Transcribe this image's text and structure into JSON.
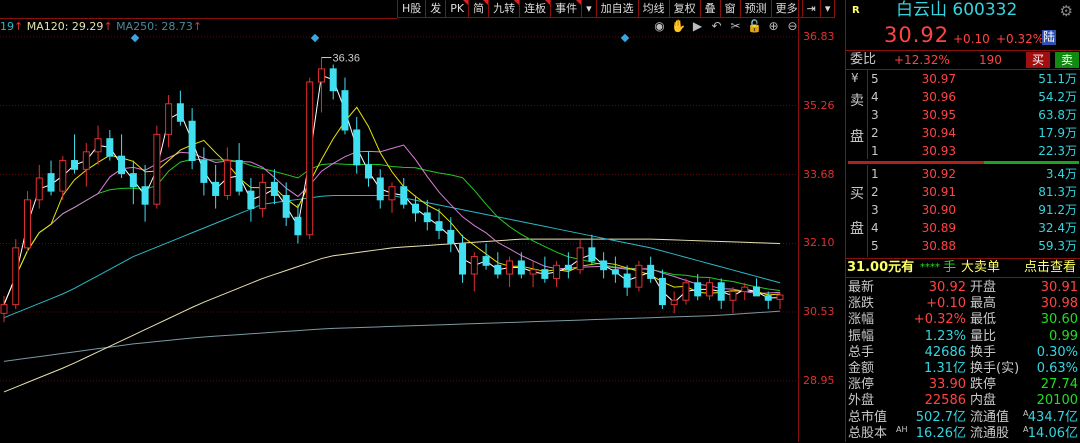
{
  "legend": {
    "partial": "19",
    "ma120": "MA120: 29.29",
    "ma250": "MA250: 28.73",
    "arrow": "↑"
  },
  "toolbar": [
    "H股",
    "发",
    "PK",
    "简",
    "九转",
    "连板",
    "事件",
    "▾",
    "加自选",
    "均线",
    "复权",
    "叠",
    "窗",
    "预测",
    "更多",
    "⇥",
    "▾"
  ],
  "toolbar_flags": [
    false,
    false,
    true,
    true,
    true,
    true,
    true,
    false,
    false,
    false,
    false,
    false,
    false,
    false,
    false,
    false,
    false
  ],
  "chart_icons": [
    "eye-icon",
    "hand-icon",
    "play-icon",
    "undo-icon",
    "scissors-icon",
    "lock-icon",
    "zoom-in-icon",
    "zoom-out-icon"
  ],
  "chart_icon_glyphs": [
    "◉",
    "✋",
    "▶",
    "↶",
    "✂",
    "🔓",
    "⊕",
    "⊖"
  ],
  "colors": {
    "up": "#e03030",
    "down": "#40e0f0",
    "ma5": "#ffffff",
    "ma10": "#e6e600",
    "ma20": "#d67fd6",
    "ma30": "#22cc22",
    "ma60": "#2bb8c8",
    "ma120": "#e8e0b0",
    "ma250": "#7a9aa0"
  },
  "chart_data": {
    "type": "candlestick",
    "y_ticks": [
      "36.83",
      "35.26",
      "33.68",
      "32.10",
      "30.53",
      "28.95"
    ],
    "ylim": [
      28.95,
      36.83
    ],
    "high_label": "36.36",
    "candles": [
      [
        30.5,
        30.9,
        30.3,
        30.7
      ],
      [
        30.7,
        32.2,
        30.6,
        32.0
      ],
      [
        32.0,
        33.3,
        31.9,
        33.1
      ],
      [
        33.1,
        33.9,
        32.9,
        33.6
      ],
      [
        33.7,
        34.0,
        33.2,
        33.3
      ],
      [
        33.3,
        34.1,
        33.1,
        34.0
      ],
      [
        34.0,
        34.6,
        33.7,
        33.8
      ],
      [
        33.8,
        34.4,
        33.4,
        34.2
      ],
      [
        34.2,
        34.8,
        33.9,
        34.5
      ],
      [
        34.5,
        34.7,
        34.0,
        34.1
      ],
      [
        34.1,
        34.6,
        33.6,
        33.7
      ],
      [
        33.7,
        34.0,
        33.0,
        33.4
      ],
      [
        33.4,
        33.9,
        32.6,
        33.0
      ],
      [
        33.0,
        34.8,
        32.9,
        34.6
      ],
      [
        34.6,
        35.5,
        34.3,
        35.3
      ],
      [
        35.3,
        35.6,
        34.8,
        34.9
      ],
      [
        34.9,
        35.2,
        33.8,
        34.0
      ],
      [
        34.0,
        34.3,
        33.2,
        33.5
      ],
      [
        33.5,
        33.9,
        32.9,
        33.2
      ],
      [
        33.2,
        34.3,
        33.1,
        34.0
      ],
      [
        34.0,
        34.4,
        33.2,
        33.3
      ],
      [
        33.3,
        33.6,
        32.6,
        32.9
      ],
      [
        32.9,
        33.7,
        32.7,
        33.5
      ],
      [
        33.5,
        33.8,
        33.0,
        33.2
      ],
      [
        33.2,
        33.5,
        32.5,
        32.7
      ],
      [
        32.7,
        33.0,
        32.1,
        32.3
      ],
      [
        32.3,
        35.9,
        32.2,
        35.8
      ],
      [
        35.8,
        36.36,
        35.1,
        36.1
      ],
      [
        36.1,
        36.2,
        35.4,
        35.6
      ],
      [
        35.6,
        35.9,
        34.6,
        34.7
      ],
      [
        34.7,
        35.0,
        33.7,
        33.9
      ],
      [
        33.9,
        34.2,
        33.4,
        33.6
      ],
      [
        33.6,
        33.8,
        32.9,
        33.1
      ],
      [
        33.1,
        33.5,
        32.8,
        33.4
      ],
      [
        33.4,
        33.6,
        32.9,
        33.0
      ],
      [
        33.0,
        33.2,
        32.6,
        32.8
      ],
      [
        32.8,
        33.1,
        32.4,
        32.6
      ],
      [
        32.6,
        32.9,
        32.2,
        32.4
      ],
      [
        32.4,
        32.7,
        31.9,
        32.1
      ],
      [
        32.1,
        32.3,
        31.2,
        31.4
      ],
      [
        31.4,
        31.9,
        31.0,
        31.8
      ],
      [
        31.8,
        32.1,
        31.5,
        31.6
      ],
      [
        31.6,
        31.9,
        31.3,
        31.4
      ],
      [
        31.4,
        31.8,
        31.1,
        31.7
      ],
      [
        31.7,
        31.9,
        31.3,
        31.4
      ],
      [
        31.4,
        31.7,
        31.1,
        31.5
      ],
      [
        31.5,
        31.8,
        31.2,
        31.3
      ],
      [
        31.3,
        31.7,
        31.1,
        31.6
      ],
      [
        31.6,
        31.9,
        31.3,
        31.5
      ],
      [
        31.5,
        32.2,
        31.4,
        32.0
      ],
      [
        32.0,
        32.3,
        31.6,
        31.7
      ],
      [
        31.7,
        31.9,
        31.3,
        31.5
      ],
      [
        31.5,
        31.8,
        31.2,
        31.4
      ],
      [
        31.4,
        31.6,
        30.9,
        31.1
      ],
      [
        31.1,
        31.7,
        31.0,
        31.6
      ],
      [
        31.6,
        31.8,
        31.2,
        31.3
      ],
      [
        31.3,
        31.5,
        30.6,
        30.7
      ],
      [
        30.7,
        31.0,
        30.5,
        30.8
      ],
      [
        30.8,
        31.3,
        30.7,
        31.2
      ],
      [
        31.2,
        31.4,
        30.8,
        30.9
      ],
      [
        30.9,
        31.3,
        30.8,
        31.2
      ],
      [
        31.2,
        31.3,
        30.6,
        30.8
      ],
      [
        30.8,
        31.1,
        30.5,
        31.0
      ],
      [
        31.0,
        31.2,
        30.8,
        31.1
      ],
      [
        31.1,
        31.3,
        30.9,
        30.9
      ],
      [
        30.9,
        31.0,
        30.6,
        30.8
      ],
      [
        30.82,
        30.98,
        30.6,
        30.92
      ]
    ],
    "ma_coarse": {
      "ma60": [
        30.4,
        31.0,
        31.8,
        32.4,
        33.0,
        33.2,
        33.2,
        32.9,
        32.6,
        32.3,
        32.0,
        31.6,
        31.2
      ],
      "ma120": [
        28.7,
        29.3,
        30.0,
        30.7,
        31.3,
        31.8,
        32.0,
        32.1,
        32.2,
        32.2,
        32.2,
        32.15,
        32.1
      ],
      "ma250": [
        29.4,
        29.6,
        29.8,
        29.95,
        30.05,
        30.15,
        30.2,
        30.25,
        30.3,
        30.35,
        30.4,
        30.45,
        30.55
      ]
    }
  },
  "panel": {
    "r_badge": "R",
    "name": "白云山 600332",
    "price": "30.92",
    "change": "+0.10",
    "pct": "+0.32%",
    "lu": "陆",
    "weibi_label": "委比",
    "weibi": "+12.32%",
    "weicha": "190",
    "buy_btn": "买",
    "sell_btn": "卖",
    "yen": "¥",
    "sell_side": [
      "卖",
      "盘"
    ],
    "buy_side": [
      "买",
      "盘"
    ],
    "asks": [
      {
        "lvl": "5",
        "p": "30.97",
        "v": "51.1万"
      },
      {
        "lvl": "4",
        "p": "30.96",
        "v": "54.2万"
      },
      {
        "lvl": "3",
        "p": "30.95",
        "v": "63.8万"
      },
      {
        "lvl": "2",
        "p": "30.94",
        "v": "17.9万"
      },
      {
        "lvl": "1",
        "p": "30.93",
        "v": "22.3万"
      }
    ],
    "bids": [
      {
        "lvl": "1",
        "p": "30.92",
        "v": "3.4万"
      },
      {
        "lvl": "2",
        "p": "30.91",
        "v": "81.3万"
      },
      {
        "lvl": "3",
        "p": "30.90",
        "v": "91.2万"
      },
      {
        "lvl": "4",
        "p": "30.89",
        "v": "32.4万"
      },
      {
        "lvl": "5",
        "p": "30.88",
        "v": "59.3万"
      }
    ],
    "big_order": {
      "price": "31.00元有",
      "stars": "****",
      "hand": "手",
      "label": "大卖单",
      "link": "点击查看"
    },
    "stats": [
      {
        "l1": "最新",
        "v1": "30.92",
        "c1": "red",
        "l2": "开盘",
        "v2": "30.91",
        "c2": "red"
      },
      {
        "l1": "涨跌",
        "v1": "+0.10",
        "c1": "red",
        "l2": "最高",
        "v2": "30.98",
        "c2": "red"
      },
      {
        "l1": "涨幅",
        "v1": "+0.32%",
        "c1": "red",
        "l2": "最低",
        "v2": "30.60",
        "c2": "green"
      },
      {
        "l1": "振幅",
        "v1": "1.23%",
        "c1": "cyan",
        "l2": "量比",
        "v2": "0.99",
        "c2": "green"
      },
      {
        "l1": "总手",
        "v1": "42686",
        "c1": "cyan",
        "l2": "换手",
        "v2": "0.30%",
        "c2": "cyan"
      },
      {
        "l1": "金额",
        "v1": "1.31亿",
        "c1": "cyan",
        "l2": "换手(实)",
        "v2": "0.63%",
        "c2": "cyan"
      },
      {
        "l1": "涨停",
        "v1": "33.90",
        "c1": "red",
        "l2": "跌停",
        "v2": "27.74",
        "c2": "green"
      },
      {
        "l1": "外盘",
        "v1": "22586",
        "c1": "red",
        "l2": "内盘",
        "v2": "20100",
        "c2": "green"
      },
      {
        "l1": "总市值",
        "v1": "502.7亿",
        "c1": "cyan",
        "l2": "流通值",
        "s2": "A",
        "v2": "434.7亿",
        "c2": "cyan"
      },
      {
        "l1": "总股本",
        "s1": "AH",
        "v1": "16.26亿",
        "c1": "cyan",
        "l2": "流通股",
        "s2": "A",
        "v2": "14.06亿",
        "c2": "cyan"
      }
    ]
  }
}
